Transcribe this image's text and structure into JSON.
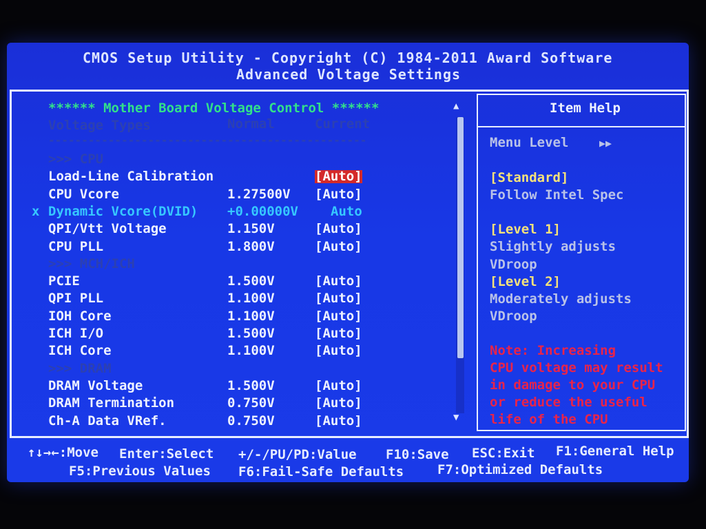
{
  "header": {
    "title": "CMOS Setup Utility - Copyright (C) 1984-2011 Award Software",
    "subtitle": "Advanced Voltage Settings"
  },
  "panel": {
    "section_title": "****** Mother Board Voltage Control ******",
    "col_types": "Voltage Types",
    "col_normal": "Normal",
    "col_current": "Current",
    "divider": "------------------------------------------------"
  },
  "rows": [
    {
      "kind": "group",
      "name": ">>> CPU"
    },
    {
      "kind": "item",
      "name": "Load-Line Calibration",
      "normal": "",
      "current": "[Auto]",
      "selected": true
    },
    {
      "kind": "item",
      "name": "CPU Vcore",
      "normal": "1.27500V",
      "current": "[Auto]"
    },
    {
      "kind": "disabled",
      "marker": "x",
      "name": "Dynamic Vcore(DVID)",
      "normal": "+0.00000V",
      "current": "Auto"
    },
    {
      "kind": "item",
      "name": "QPI/Vtt Voltage",
      "normal": "1.150V",
      "current": "[Auto]"
    },
    {
      "kind": "item",
      "name": "CPU PLL",
      "normal": "1.800V",
      "current": "[Auto]"
    },
    {
      "kind": "group",
      "name": ">>> MCH/ICH"
    },
    {
      "kind": "item",
      "name": "PCIE",
      "normal": "1.500V",
      "current": "[Auto]"
    },
    {
      "kind": "item",
      "name": "QPI PLL",
      "normal": "1.100V",
      "current": "[Auto]"
    },
    {
      "kind": "item",
      "name": "IOH Core",
      "normal": "1.100V",
      "current": "[Auto]"
    },
    {
      "kind": "item",
      "name": "ICH I/O",
      "normal": "1.500V",
      "current": "[Auto]"
    },
    {
      "kind": "item",
      "name": "ICH Core",
      "normal": "1.100V",
      "current": "[Auto]"
    },
    {
      "kind": "group",
      "name": ">>> DRAM"
    },
    {
      "kind": "item",
      "name": "DRAM Voltage",
      "normal": "1.500V",
      "current": "[Auto]"
    },
    {
      "kind": "item",
      "name": "DRAM Termination",
      "normal": "0.750V",
      "current": "[Auto]"
    },
    {
      "kind": "item",
      "name": "Ch-A Data VRef.",
      "normal": "0.750V",
      "current": "[Auto]"
    }
  ],
  "help": {
    "title": "Item Help",
    "menu_level": "Menu Level",
    "menu_level_arrows": "▶▶",
    "lines": [
      {
        "text": "[Standard]",
        "style": "yellow"
      },
      {
        "text": "Follow Intel Spec",
        "style": "helptext"
      },
      {
        "text": "",
        "style": "helptext"
      },
      {
        "text": "[Level 1]",
        "style": "yellow"
      },
      {
        "text": "Slightly adjusts",
        "style": "helptext"
      },
      {
        "text": "VDroop",
        "style": "helptext"
      },
      {
        "text": "[Level 2]",
        "style": "yellow"
      },
      {
        "text": "Moderately adjusts",
        "style": "helptext"
      },
      {
        "text": "VDroop",
        "style": "helptext"
      },
      {
        "text": "",
        "style": "helptext"
      },
      {
        "text": "Note: Increasing",
        "style": "red"
      },
      {
        "text": "CPU voltage may result",
        "style": "red"
      },
      {
        "text": "in damage to your CPU",
        "style": "red"
      },
      {
        "text": "or reduce the useful",
        "style": "red"
      },
      {
        "text": "life of the CPU",
        "style": "red"
      }
    ]
  },
  "scroll": {
    "up": "▲",
    "down": "▼"
  },
  "footer": {
    "move": "↑↓→←:Move",
    "select": "Enter:Select",
    "value": "+/-/PU/PD:Value",
    "save": "F10:Save",
    "exit": "ESC:Exit",
    "help": "F1:General Help",
    "prev": "F5:Previous Values",
    "failsafe": "F6:Fail-Safe Defaults",
    "optimized": "F7:Optimized Defaults"
  },
  "colors": {
    "background": "#1a3ae8",
    "title_green": "#32e08a",
    "selection": "#d42a2a",
    "warning": "#e8244a",
    "help_option": "#f6e27a"
  }
}
